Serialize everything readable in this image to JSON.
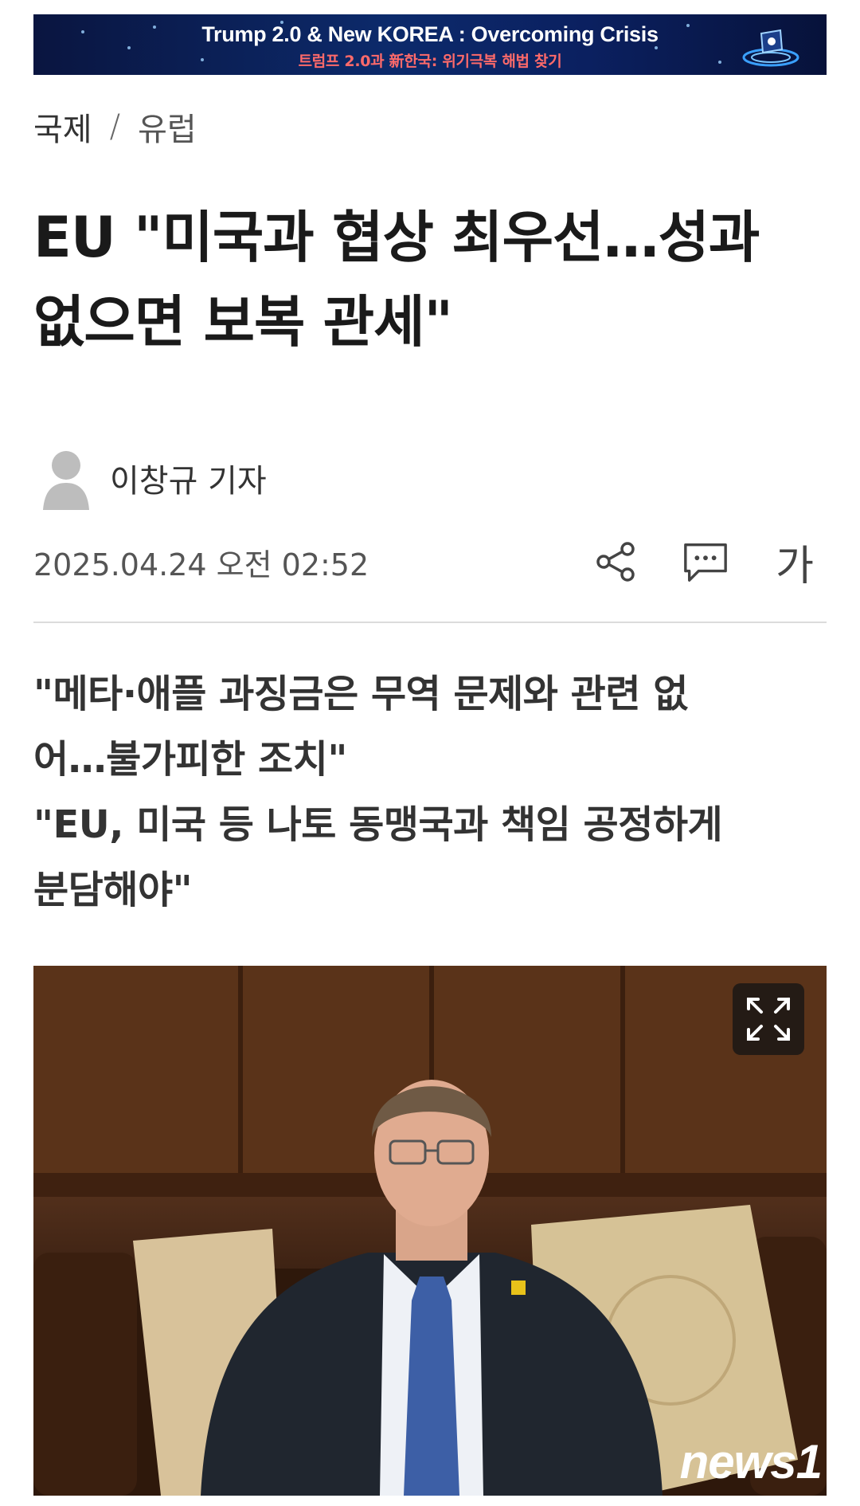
{
  "banner": {
    "title": "Trump 2.0 & New KOREA : Overcoming Crisis",
    "subtitle": "트럼프 2.0과 新한국: 위기극복 해법 찾기"
  },
  "breadcrumb": {
    "section": "국제",
    "separator": "/",
    "subsection": "유럽"
  },
  "article": {
    "headline_line1": "EU \"미국과 협상 최우선…성과",
    "headline_line2": "없으면 보복 관세\"",
    "author": "이창규 기자",
    "date": "2025.04.24 오전 02:52",
    "summary": [
      "\"메타·애플 과징금은 무역 문제와 관련 없",
      "어…불가피한 조치\"",
      "\"EU, 미국 등 나토 동맹국과 책임 공정하게",
      "분담해야\""
    ]
  },
  "toolbar": {
    "share_icon": "share-icon",
    "comment_icon": "comment-icon",
    "font_size_label": "가"
  },
  "photo": {
    "watermark": "news1",
    "expand_icon": "expand-icon"
  },
  "colors": {
    "banner_bg": "#0c2a6b",
    "banner_sub": "#ff6a6a",
    "headline": "#1a1a1a"
  }
}
